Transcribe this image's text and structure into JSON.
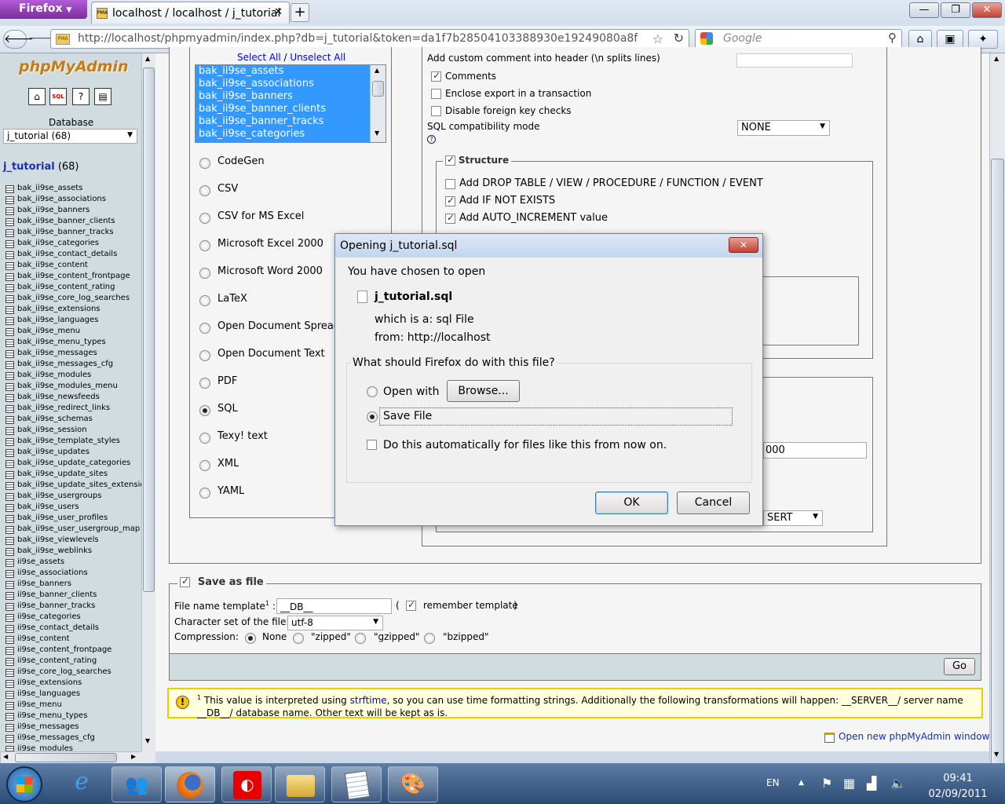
{
  "browser": {
    "menu_button": "Firefox",
    "tab_title": "localhost / localhost / j_tutorial",
    "new_tab": "+",
    "url": "http://localhost/phpmyadmin/index.php?db=j_tutorial&token=da1f7b28504103388930e19249080a8f",
    "search_placeholder": "Google",
    "win_min": "—",
    "win_max": "❐",
    "win_close": "✕"
  },
  "sidebar": {
    "logo": "phpMyAdmin",
    "database_label": "Database",
    "database_select": "j_tutorial (68)",
    "db_name": "j_tutorial",
    "db_count": "(68)",
    "tables": [
      "bak_ii9se_assets",
      "bak_ii9se_associations",
      "bak_ii9se_banners",
      "bak_ii9se_banner_clients",
      "bak_ii9se_banner_tracks",
      "bak_ii9se_categories",
      "bak_ii9se_contact_details",
      "bak_ii9se_content",
      "bak_ii9se_content_frontpage",
      "bak_ii9se_content_rating",
      "bak_ii9se_core_log_searches",
      "bak_ii9se_extensions",
      "bak_ii9se_languages",
      "bak_ii9se_menu",
      "bak_ii9se_menu_types",
      "bak_ii9se_messages",
      "bak_ii9se_messages_cfg",
      "bak_ii9se_modules",
      "bak_ii9se_modules_menu",
      "bak_ii9se_newsfeeds",
      "bak_ii9se_redirect_links",
      "bak_ii9se_schemas",
      "bak_ii9se_session",
      "bak_ii9se_template_styles",
      "bak_ii9se_updates",
      "bak_ii9se_update_categories",
      "bak_ii9se_update_sites",
      "bak_ii9se_update_sites_extensio",
      "bak_ii9se_usergroups",
      "bak_ii9se_users",
      "bak_ii9se_user_profiles",
      "bak_ii9se_user_usergroup_map",
      "bak_ii9se_viewlevels",
      "bak_ii9se_weblinks",
      "ii9se_assets",
      "ii9se_associations",
      "ii9se_banners",
      "ii9se_banner_clients",
      "ii9se_banner_tracks",
      "ii9se_categories",
      "ii9se_contact_details",
      "ii9se_content",
      "ii9se_content_frontpage",
      "ii9se_content_rating",
      "ii9se_core_log_searches",
      "ii9se_extensions",
      "ii9se_languages",
      "ii9se_menu",
      "ii9se_menu_types",
      "ii9se_messages",
      "ii9se_messages_cfg",
      "ii9se_modules"
    ]
  },
  "export": {
    "select_all": "Select All",
    "separator": " / ",
    "unselect_all": "Unselect All",
    "selected_tables": [
      "bak_ii9se_assets",
      "bak_ii9se_associations",
      "bak_ii9se_banners",
      "bak_ii9se_banner_clients",
      "bak_ii9se_banner_tracks",
      "bak_ii9se_categories"
    ],
    "formats": [
      "CodeGen",
      "CSV",
      "CSV for MS Excel",
      "Microsoft Excel 2000",
      "Microsoft Word 2000",
      "LaTeX",
      "Open Document Spreadsh",
      "Open Document Text",
      "PDF",
      "SQL",
      "Texy! text",
      "XML",
      "YAML"
    ],
    "selected_format": "SQL",
    "options": {
      "header_comment": "Add custom comment into header (\\n splits lines)",
      "comments": "Comments",
      "transaction": "Enclose export in a transaction",
      "foreign_keys": "Disable foreign key checks",
      "compat_label": "SQL compatibility mode",
      "compat_value": "NONE",
      "help": "?"
    },
    "structure": {
      "legend": "Structure",
      "drop": "Add DROP TABLE / VIEW / PROCEDURE / FUNCTION / EVENT",
      "if_not_exists": "Add IF NOT EXISTS",
      "auto_increment": "Add AUTO_INCREMENT value"
    },
    "partial_value": "000",
    "partial_select": "SERT"
  },
  "save_file": {
    "legend": "Save as file",
    "template_label": "File name template",
    "template_sup": "1",
    "template_colon": ":",
    "template_value": "__DB__",
    "paren_open": "(",
    "remember": "remember template",
    "paren_close": ")",
    "charset_label": "Character set of the file:",
    "charset_value": "utf-8",
    "compression_label": "Compression:",
    "compression": [
      "None",
      "\"zipped\"",
      "\"gzipped\"",
      "\"bzipped\""
    ],
    "go": "Go"
  },
  "notice": {
    "sup": "1",
    "text1": " This value is interpreted using ",
    "link": "strftime",
    "text2": ", so you can use time formatting strings. Additionally the following transformations will happen: __SERVER__/ server name __DB__/ database name. Other text will be kept as is."
  },
  "new_window": "Open new phpMyAdmin window",
  "dialog": {
    "title": "Opening j_tutorial.sql",
    "close": "✕",
    "chosen": "You have chosen to open",
    "filename": "j_tutorial.sql",
    "which_is_label": "which is a:",
    "which_is_value": "sql File",
    "from_label": "from:",
    "from_value": "http://localhost",
    "question": "What should Firefox do with this file?",
    "open_with": "Open with",
    "browse": "Browse...",
    "save_file": "Save File",
    "auto": "Do this automatically for files like this from now on.",
    "ok": "OK",
    "cancel": "Cancel"
  },
  "taskbar": {
    "lang": "EN",
    "time": "09:41",
    "date": "02/09/2011"
  }
}
